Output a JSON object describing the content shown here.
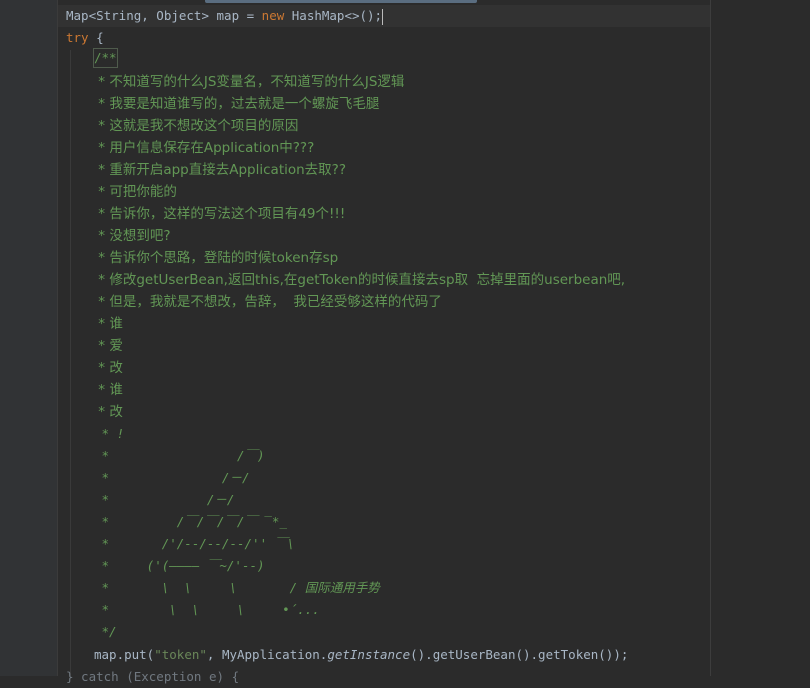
{
  "editor": {
    "line_map_decl": {
      "type_part": "Map<String, Object> map = ",
      "kw_new": "new",
      "ctor": " HashMap<>();"
    },
    "line_try": {
      "kw": "try",
      "rest": " {"
    },
    "doc_open": "/**",
    "comment_lines": [
      " * 不知道写的什么JS变量名，不知道写的什么JS逻辑",
      " * 我要是知道谁写的，过去就是一个螺旋飞毛腿",
      " * 这就是我不想改这个项目的原因",
      " * 用户信息保存在Application中???",
      " * 重新开启app直接去Application去取??",
      " * 可把你能的",
      " * 告诉你，这样的写法这个项目有49个!!!",
      " * 没想到吧?",
      " * 告诉你个思路，登陆的时候token存sp",
      " * 修改getUserBean,返回this,在getToken的时候直接去sp取  忘掉里面的userbean吧,",
      " * 但是，我就是不想改，告辞，  我已经受够这样的代码了",
      " * 谁",
      " * 爱",
      " * 改",
      " * 谁",
      " * 改",
      " * !"
    ],
    "art_lines": [
      " *                 /￣)",
      " *               /－/",
      " *             /－/",
      " *         /￣/￣/￣/￣ ‾*_",
      " *       /'/--/--/--/'' ￣\\",
      " *     ('(———— ￣~/'--)",
      " *       \\  \\     \\       / 国际通用手势",
      " *        \\  \\     \\     •´..."
    ],
    "doc_close": " */",
    "put_line": {
      "pre": "map.put(",
      "str": "\"token\"",
      "mid": ", MyApplication.",
      "it_call": "getInstance",
      "post": "().getUserBean().getToken());"
    },
    "catch_line": "} catch (Exception e) {"
  }
}
